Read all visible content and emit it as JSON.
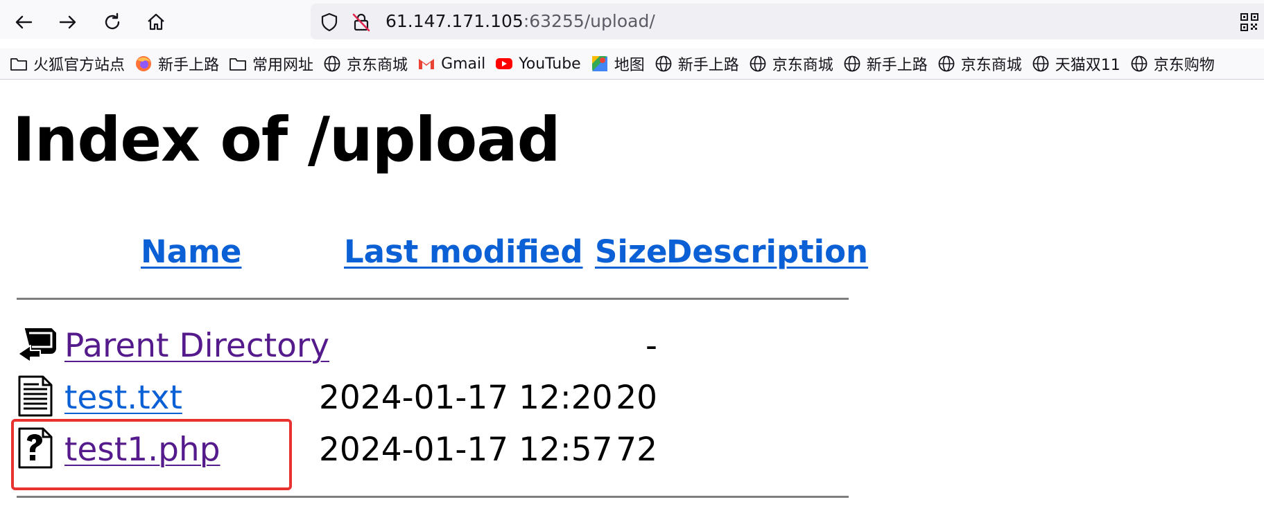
{
  "browser": {
    "url_host": "61.147.171.105",
    "url_rest": ":63255/upload/",
    "nav": [
      "back-icon",
      "forward-icon",
      "reload-icon",
      "home-icon"
    ]
  },
  "bookmarks": [
    {
      "label": "火狐官方站点",
      "icon": "folder-icon"
    },
    {
      "label": "新手上路",
      "icon": "firefox-icon"
    },
    {
      "label": "常用网址",
      "icon": "folder-icon"
    },
    {
      "label": "京东商城",
      "icon": "globe-icon"
    },
    {
      "label": "Gmail",
      "icon": "gmail-icon"
    },
    {
      "label": "YouTube",
      "icon": "youtube-icon"
    },
    {
      "label": "地图",
      "icon": "maps-icon"
    },
    {
      "label": "新手上路",
      "icon": "globe-icon"
    },
    {
      "label": "京东商城",
      "icon": "globe-icon"
    },
    {
      "label": "新手上路",
      "icon": "globe-icon"
    },
    {
      "label": "京东商城",
      "icon": "globe-icon"
    },
    {
      "label": "天猫双11",
      "icon": "globe-icon"
    },
    {
      "label": "京东购物",
      "icon": "globe-icon"
    }
  ],
  "page": {
    "title": "Index of /upload",
    "columns": {
      "name": "Name",
      "last_modified": "Last modified",
      "size": "Size",
      "description": "Description"
    },
    "rows": [
      {
        "name": "Parent Directory",
        "date": "",
        "size": "-",
        "icon": "back-folder-icon"
      },
      {
        "name": "test.txt",
        "date": "2024-01-17 12:20",
        "size": "20",
        "icon": "text-file-icon"
      },
      {
        "name": "test1.php",
        "date": "2024-01-17 12:57",
        "size": "72",
        "icon": "unknown-file-icon"
      }
    ]
  },
  "colors": {
    "link": "#0c60d6",
    "visited": "#551a8b",
    "highlight": "#e8322f"
  }
}
